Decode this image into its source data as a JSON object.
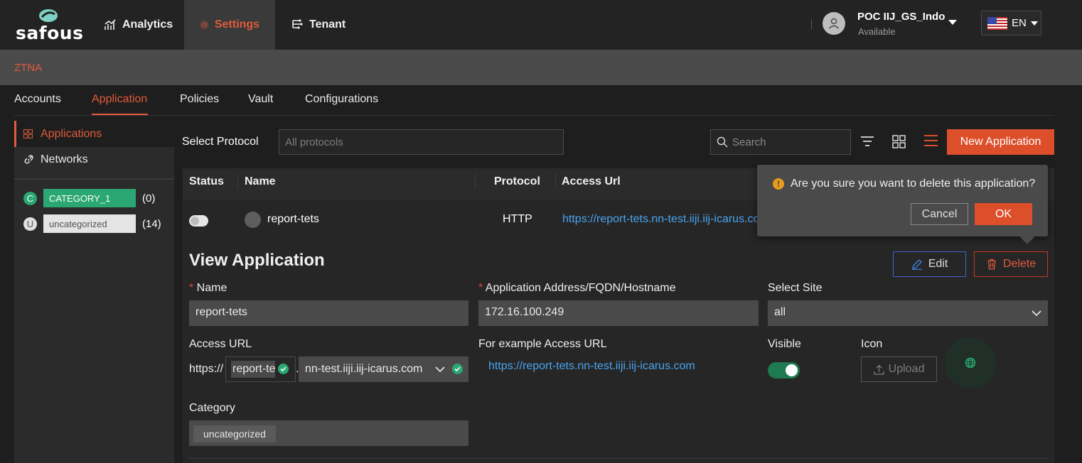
{
  "brand": {
    "logo_text": "safous"
  },
  "topnav": {
    "analytics": "Analytics",
    "settings": "Settings",
    "tenant": "Tenant"
  },
  "user": {
    "name": "POC IIJ_GS_Indo",
    "status": "Available"
  },
  "language": {
    "code": "EN"
  },
  "section": {
    "title": "ZTNA"
  },
  "tabs": [
    "Accounts",
    "Application",
    "Policies",
    "Vault",
    "Configurations"
  ],
  "sidebar": {
    "items": [
      {
        "label": "Applications",
        "icon": "grid-icon"
      },
      {
        "label": "Networks",
        "icon": "link-icon"
      }
    ],
    "categories": [
      {
        "letter": "C",
        "name": "CATEGORY_1",
        "count": "(0)",
        "color": "#2aa772"
      },
      {
        "letter": "U",
        "name": "uncategorized",
        "count": "(14)",
        "color": "#e4e4e4"
      }
    ]
  },
  "toolbar": {
    "protocol_label": "Select Protocol",
    "protocol_placeholder": "All protocols",
    "search_placeholder": "Search",
    "new_app_label": "New Application"
  },
  "table": {
    "columns": [
      "Status",
      "Name",
      "Protocol",
      "Access Url"
    ],
    "rows": [
      {
        "name": "report-tets",
        "protocol": "HTTP",
        "url": "https://report-tets.nn-test.iiji.iij-icarus.com",
        "enabled": false
      }
    ]
  },
  "detail": {
    "title": "View Application",
    "edit_label": "Edit",
    "delete_label": "Delete",
    "name_label": "Name",
    "name_value": "report-tets",
    "address_label": "Application Address/FQDN/Hostname",
    "address_value": "172.16.100.249",
    "site_label": "Select Site",
    "site_value": "all",
    "access_url_label": "Access URL",
    "access_url_prefix": "https://",
    "access_url_subdomain": "report-tets",
    "access_url_dot": ".",
    "access_url_domain": "nn-test.iiji.iij-icarus.com",
    "example_label": "For example Access URL",
    "example_url": "https://report-tets.nn-test.iiji.iij-icarus.com",
    "visible_label": "Visible",
    "visible": true,
    "icon_label": "Icon",
    "upload_label": "Upload",
    "category_label": "Category",
    "category_value": "uncategorized"
  },
  "popconfirm": {
    "message": "Are you sure you want to delete this application?",
    "cancel": "Cancel",
    "ok": "OK"
  },
  "colors": {
    "accent": "#dd4e2b",
    "link": "#4aa3f0",
    "success": "#2aa772",
    "edit_border": "#3f64c9"
  }
}
